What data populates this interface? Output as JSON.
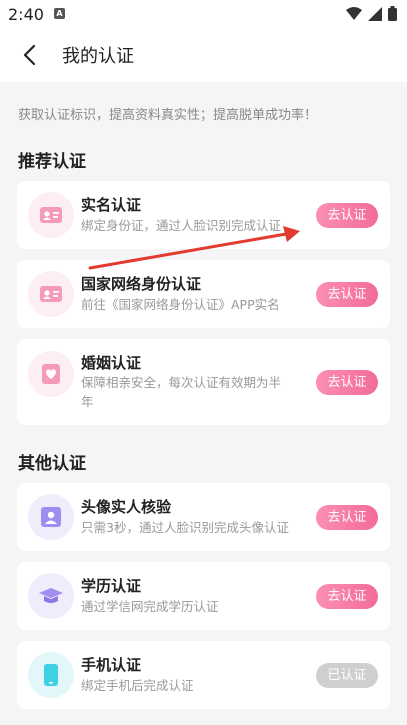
{
  "status_bar": {
    "time": "2:40",
    "notif_badge": "A"
  },
  "nav": {
    "title": "我的认证"
  },
  "intro": "获取认证标识，提高资料真实性；提高脱单成功率！",
  "sections": {
    "recommended": {
      "title": "推荐认证",
      "items": [
        {
          "name": "实名认证",
          "desc": "绑定身份证，通过人脸识别完成认证",
          "button": "去认证",
          "icon": "id-card-icon"
        },
        {
          "name": "国家网络身份认证",
          "desc": "前往《国家网络身份认证》APP实名",
          "button": "去认证",
          "icon": "id-card-icon"
        },
        {
          "name": "婚姻认证",
          "desc": "保障相亲安全，每次认证有效期为半年",
          "desc_line1": "保障相亲安全，每次认证有效期为半",
          "desc_line2": "年",
          "button": "去认证",
          "icon": "marriage-certificate-icon"
        }
      ]
    },
    "other": {
      "title": "其他认证",
      "items": [
        {
          "name": "头像实人核验",
          "desc": "只需3秒，通过人脸识别完成头像认证",
          "button": "去认证",
          "icon": "portrait-icon"
        },
        {
          "name": "学历认证",
          "desc": "通过学信网完成学历认证",
          "button": "去认证",
          "icon": "graduation-cap-icon"
        },
        {
          "name": "手机认证",
          "desc": "绑定手机后完成认证",
          "button": "已认证",
          "icon": "phone-icon"
        }
      ]
    }
  },
  "colors": {
    "accent_pink": "#f26b9c",
    "arrow_red": "#e23a2e",
    "done_gray": "#cfcfcf"
  }
}
